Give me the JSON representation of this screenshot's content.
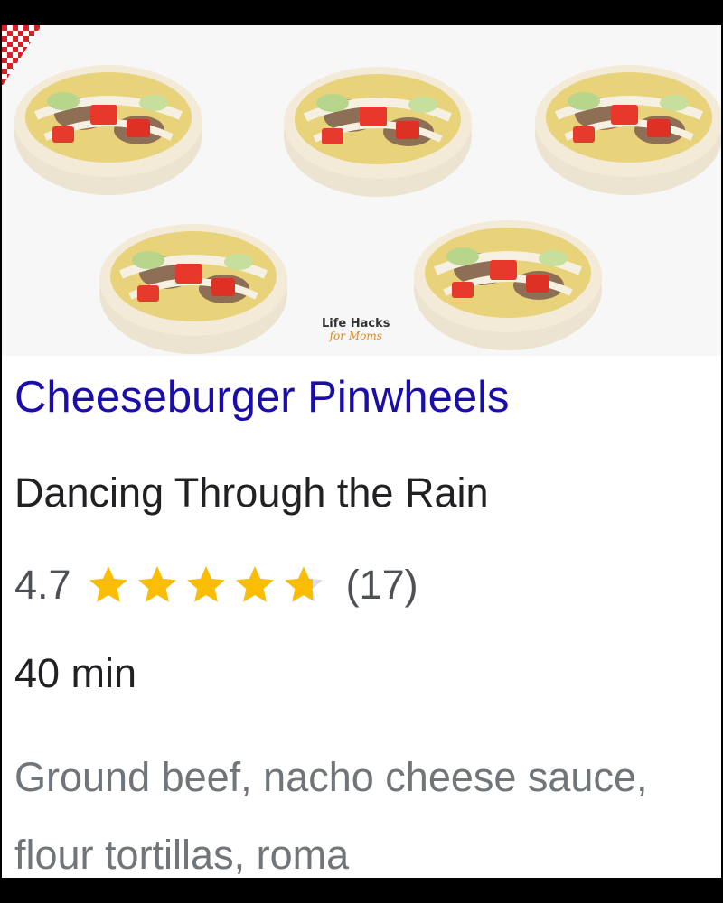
{
  "recipe": {
    "title": "Cheeseburger Pinwheels",
    "source": "Dancing Through the Rain",
    "rating": "4.7",
    "rating_fraction": 0.94,
    "review_count": "(17)",
    "time": "40 min",
    "ingredients": "Ground beef, nacho cheese sauce, flour tortillas, roma"
  },
  "image": {
    "watermark_line1": "Life Hacks",
    "watermark_line2": "for Moms"
  },
  "colors": {
    "title_link": "#1a0dab",
    "star_fill": "#fbbc04",
    "star_empty": "#dadce0"
  }
}
